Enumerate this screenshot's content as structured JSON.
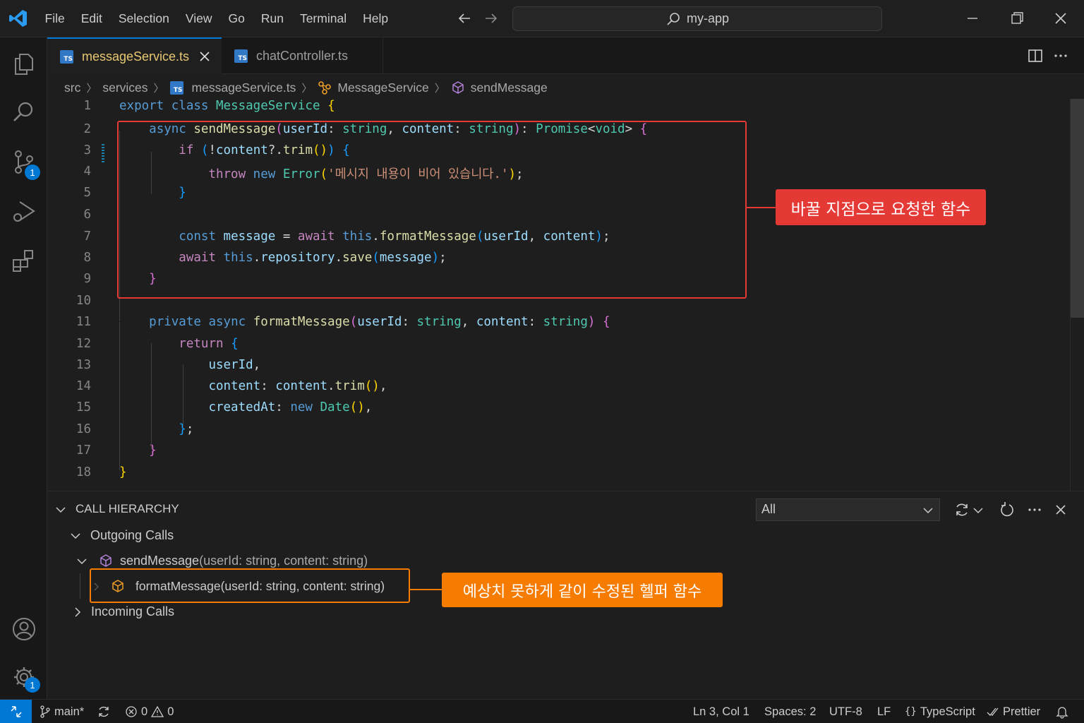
{
  "titlebar": {
    "menu": [
      "File",
      "Edit",
      "Selection",
      "View",
      "Go",
      "Run",
      "Terminal",
      "Help"
    ],
    "search_text": "my-app"
  },
  "activity": {
    "source_control_badge": "1",
    "settings_badge": "1"
  },
  "tabs": [
    {
      "label": "messageService.ts",
      "icon": "TS"
    },
    {
      "label": "chatController.ts",
      "icon": "TS"
    }
  ],
  "breadcrumb": [
    "src",
    "services",
    "messageService.ts",
    "MessageService",
    "sendMessage"
  ],
  "editor": {
    "line_numbers": [
      "1",
      "2",
      "3",
      "4",
      "5",
      "6",
      "7",
      "8",
      "9",
      "10",
      "11",
      "12",
      "13",
      "14",
      "15",
      "16",
      "17",
      "18"
    ],
    "lines": [
      [
        [
          "k",
          "export"
        ],
        [
          "p",
          " "
        ],
        [
          "k",
          "class"
        ],
        [
          "p",
          " "
        ],
        [
          "t",
          "MessageService"
        ],
        [
          "p",
          " "
        ],
        [
          "b1",
          "{"
        ]
      ],
      [
        [
          "p",
          "    "
        ],
        [
          "k",
          "async"
        ],
        [
          "p",
          " "
        ],
        [
          "f",
          "sendMessage"
        ],
        [
          "b2",
          "("
        ],
        [
          "v",
          "userId"
        ],
        [
          "p",
          ": "
        ],
        [
          "t",
          "string"
        ],
        [
          "p",
          ", "
        ],
        [
          "v",
          "content"
        ],
        [
          "p",
          ": "
        ],
        [
          "t",
          "string"
        ],
        [
          "b2",
          ")"
        ],
        [
          "p",
          ": "
        ],
        [
          "t",
          "Promise"
        ],
        [
          "p",
          "<"
        ],
        [
          "t",
          "void"
        ],
        [
          "p",
          "> "
        ],
        [
          "b2",
          "{"
        ]
      ],
      [
        [
          "p",
          "        "
        ],
        [
          "c",
          "if"
        ],
        [
          "p",
          " "
        ],
        [
          "b3",
          "("
        ],
        [
          "p",
          "!"
        ],
        [
          "v",
          "content"
        ],
        [
          "p",
          "?."
        ],
        [
          "f",
          "trim"
        ],
        [
          "b1",
          "()"
        ],
        [
          "b3",
          ")"
        ],
        [
          "p",
          " "
        ],
        [
          "b3",
          "{"
        ]
      ],
      [
        [
          "p",
          "            "
        ],
        [
          "c",
          "throw"
        ],
        [
          "p",
          " "
        ],
        [
          "k",
          "new"
        ],
        [
          "p",
          " "
        ],
        [
          "t",
          "Error"
        ],
        [
          "b1",
          "("
        ],
        [
          "s",
          "'메시지 내용이 비어 있습니다.'"
        ],
        [
          "b1",
          ")"
        ],
        [
          "p",
          ";"
        ]
      ],
      [
        [
          "p",
          "        "
        ],
        [
          "b3",
          "}"
        ]
      ],
      [],
      [
        [
          "p",
          "        "
        ],
        [
          "k",
          "const"
        ],
        [
          "p",
          " "
        ],
        [
          "v",
          "message"
        ],
        [
          "p",
          " = "
        ],
        [
          "c",
          "await"
        ],
        [
          "p",
          " "
        ],
        [
          "k",
          "this"
        ],
        [
          "p",
          "."
        ],
        [
          "f",
          "formatMessage"
        ],
        [
          "b3",
          "("
        ],
        [
          "v",
          "userId"
        ],
        [
          "p",
          ", "
        ],
        [
          "v",
          "content"
        ],
        [
          "b3",
          ")"
        ],
        [
          "p",
          ";"
        ]
      ],
      [
        [
          "p",
          "        "
        ],
        [
          "c",
          "await"
        ],
        [
          "p",
          " "
        ],
        [
          "k",
          "this"
        ],
        [
          "p",
          "."
        ],
        [
          "v",
          "repository"
        ],
        [
          "p",
          "."
        ],
        [
          "f",
          "save"
        ],
        [
          "b3",
          "("
        ],
        [
          "v",
          "message"
        ],
        [
          "b3",
          ")"
        ],
        [
          "p",
          ";"
        ]
      ],
      [
        [
          "p",
          "    "
        ],
        [
          "b2",
          "}"
        ]
      ],
      [],
      [
        [
          "p",
          "    "
        ],
        [
          "k",
          "private"
        ],
        [
          "p",
          " "
        ],
        [
          "k",
          "async"
        ],
        [
          "p",
          " "
        ],
        [
          "f",
          "formatMessage"
        ],
        [
          "b2",
          "("
        ],
        [
          "v",
          "userId"
        ],
        [
          "p",
          ": "
        ],
        [
          "t",
          "string"
        ],
        [
          "p",
          ", "
        ],
        [
          "v",
          "content"
        ],
        [
          "p",
          ": "
        ],
        [
          "t",
          "string"
        ],
        [
          "b2",
          ")"
        ],
        [
          "p",
          " "
        ],
        [
          "b2",
          "{"
        ]
      ],
      [
        [
          "p",
          "        "
        ],
        [
          "c",
          "return"
        ],
        [
          "p",
          " "
        ],
        [
          "b3",
          "{"
        ]
      ],
      [
        [
          "p",
          "            "
        ],
        [
          "v",
          "userId"
        ],
        [
          "p",
          ","
        ]
      ],
      [
        [
          "p",
          "            "
        ],
        [
          "v",
          "content"
        ],
        [
          "p",
          ": "
        ],
        [
          "v",
          "content"
        ],
        [
          "p",
          "."
        ],
        [
          "f",
          "trim"
        ],
        [
          "b1",
          "()"
        ],
        [
          "p",
          ","
        ]
      ],
      [
        [
          "p",
          "            "
        ],
        [
          "v",
          "createdAt"
        ],
        [
          "p",
          ": "
        ],
        [
          "k",
          "new"
        ],
        [
          "p",
          " "
        ],
        [
          "t",
          "Date"
        ],
        [
          "b1",
          "()"
        ],
        [
          "p",
          ","
        ]
      ],
      [
        [
          "p",
          "        "
        ],
        [
          "b3",
          "}"
        ],
        [
          "p",
          ";"
        ]
      ],
      [
        [
          "p",
          "    "
        ],
        [
          "b2",
          "}"
        ]
      ],
      [
        [
          "b1",
          "}"
        ]
      ]
    ]
  },
  "annotations": {
    "red_label": "바꿀 지점으로 요청한 함수",
    "orange_label": "예상치 못하게 같이 수정된 헬퍼 함수"
  },
  "panel": {
    "title": "CALL HIERARCHY",
    "filter_value": "All",
    "outgoing_label": "Outgoing Calls",
    "send_name": "sendMessage",
    "send_detail": "(userId: string, content: string)",
    "format_label": "formatMessage(userId: string, content: string)",
    "incoming_label": "Incoming Calls"
  },
  "statusbar": {
    "branch": "main*",
    "errors": "0",
    "warnings": "0",
    "position": "Ln 3, Col 1",
    "spaces": "Spaces: 2",
    "encoding": "UTF-8",
    "eol": "LF",
    "language": "TypeScript",
    "formatter": "Prettier"
  }
}
